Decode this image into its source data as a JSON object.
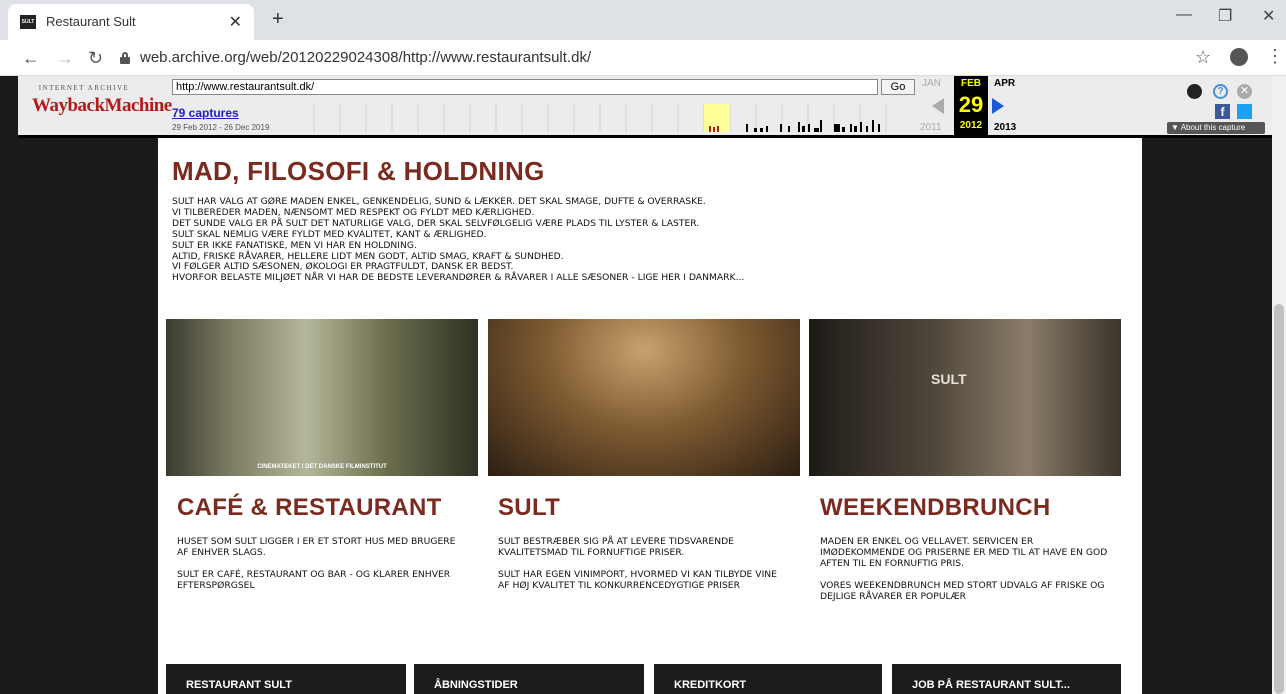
{
  "browser": {
    "tab_title": "Restaurant Sult",
    "favicon_text": "SULT",
    "url": "web.archive.org/web/20120229024308/http://www.restaurantsult.dk/",
    "icons": [
      "back-icon",
      "forward-icon",
      "reload-icon",
      "lock-icon",
      "star-icon",
      "account-icon",
      "menu-icon"
    ]
  },
  "wayback": {
    "logo_top": "INTERNET ARCHIVE",
    "logo_main": "WaybackMachine",
    "url_value": "http://www.restaurantsult.dk/",
    "go_label": "Go",
    "captures": "79 captures",
    "range": "29 Feb 2012 - 26 Dec 2019",
    "prev_month": "JAN",
    "current_month": "FEB",
    "next_month": "APR",
    "day": "29",
    "prev_year": "2011",
    "current_year": "2012",
    "next_year": "2013",
    "about": "▼ About this capture",
    "accent": "#ffff00"
  },
  "page": {
    "headline": "MAD, FILOSOFI & HOLDNING",
    "intro": [
      "SULT HAR VALG AT GØRE MADEN ENKEL, GENKENDELIG, SUND & LÆKKER. DET SKAL SMAGE, DUFTE & OVERRASKE.",
      "VI TILBEREDER MADEN, NÆNSOMT MED RESPEKT OG FYLDT MED KÆRLIGHED.",
      "DET SUNDE VALG ER PÅ SULT DET NATURLIGE VALG, DER SKAL SELVFØLGELIG VÆRE PLADS TIL LYSTER & LASTER.",
      "SULT SKAL NEMLIG VÆRE FYLDT MED KVALITET, KANT & ÆRLIGHED.",
      "SULT ER IKKE FANATISKE, MEN VI HAR EN HOLDNING.",
      "ALTID, FRISKE RÅVARER, HELLERE LIDT MEN GODT, ALTID SMAG, KRAFT & SUNDHED.",
      "VI FØLGER ALTID SÆSONEN, ØKOLOGI ER PRAGTFULDT, DANSK ER BEDST.",
      "HVORFOR BELASTE MILJØET NÅR VI HAR DE BEDSTE LEVERANDØRER & RÅVARER I ALLE SÆSONER - LIGE HER I DANMARK..."
    ],
    "photo1_caption": "CINEMATEKET / DET DANSKE FILMINSTITUT",
    "photo3_menu_text": "SULT",
    "columns": [
      {
        "heading": "CAFÉ & RESTAURANT",
        "p1": "HUSET SOM SULT LIGGER I ER ET STORT HUS MED BRUGERE AF ENHVER SLAGS.",
        "p2": "SULT ER CAFÉ, RESTAURANT OG BAR - OG KLARER ENHVER EFTERSPØRGSEL"
      },
      {
        "heading": "SULT",
        "p1": "SULT BESTRÆBER SIG PÅ AT LEVERE TIDSVARENDE KVALITETSMAD TIL FORNUFTIGE PRISER.",
        "p2": "SULT HAR EGEN VINIMPORT, HVORMED VI KAN TILBYDE VINE AF HØJ KVALITET TIL KONKURRENCEDYGTIGE PRISER"
      },
      {
        "heading": "WEEKENDBRUNCH",
        "p1": "MADEN ER ENKEL OG VELLAVET. SERVICEN ER IMØDEKOMMENDE OG PRISERNE ER MED TIL AT HAVE EN GOD AFTEN TIL EN FORNUFTIG PRIS.",
        "p2": "VORES WEEKENDBRUNCH MED STORT UDVALG AF FRISKE OG DEJLIGE RÅVARER ER POPULÆR"
      }
    ],
    "footer_tabs": [
      "RESTAURANT SULT",
      "ÅBNINGSTIDER",
      "KREDITKORT",
      "JOB PÅ RESTAURANT SULT..."
    ],
    "colors": {
      "heading": "#7a2a1e",
      "background": "#1a1a1a",
      "footer": "#1c1c1c"
    }
  }
}
